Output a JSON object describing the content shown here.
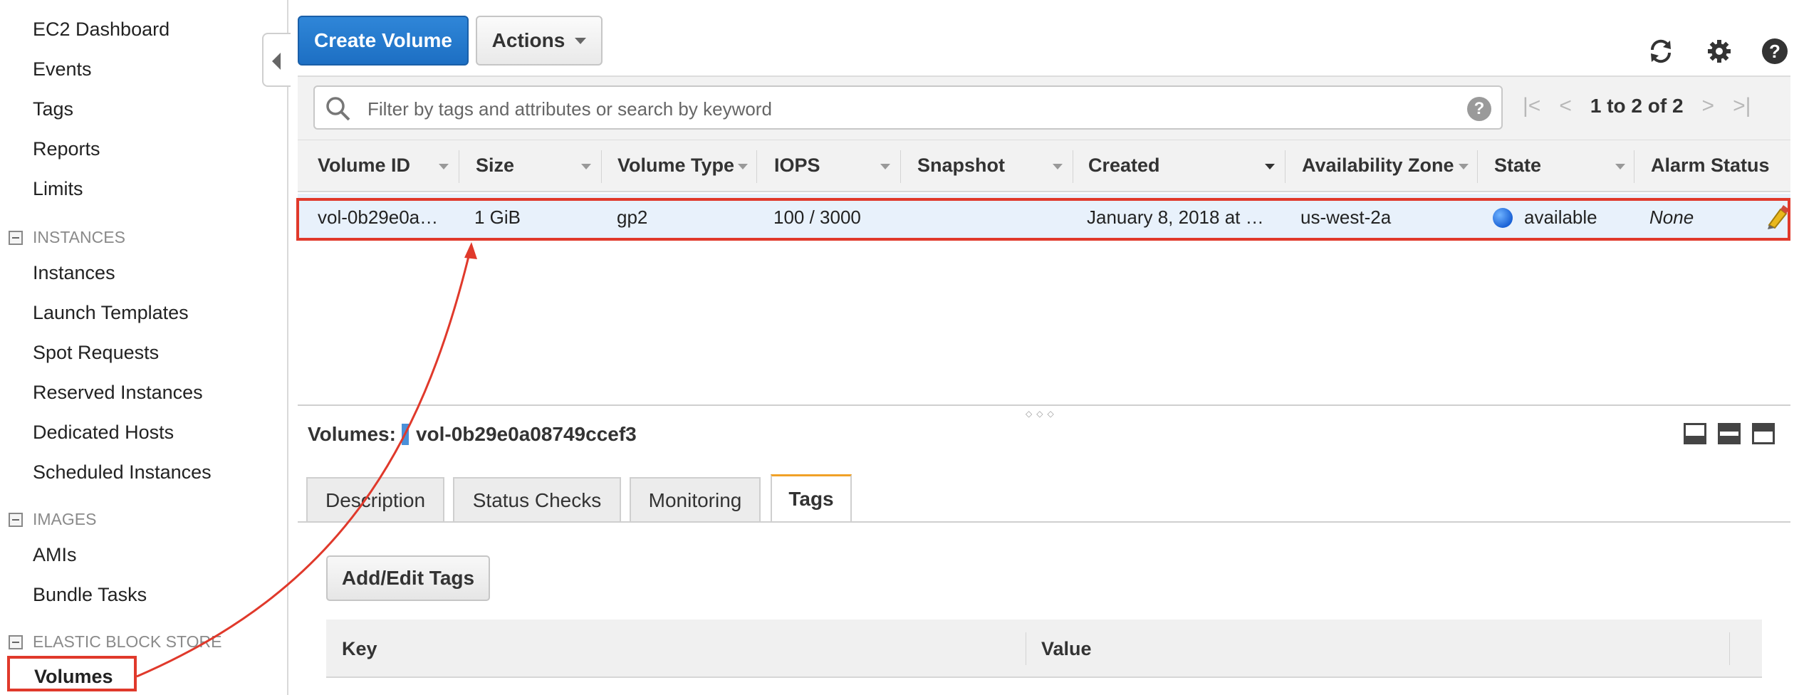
{
  "sidebar": {
    "items_top": [
      "EC2 Dashboard",
      "Events",
      "Tags",
      "Reports",
      "Limits"
    ],
    "group_instances": "INSTANCES",
    "items_instances": [
      "Instances",
      "Launch Templates",
      "Spot Requests",
      "Reserved Instances",
      "Dedicated Hosts",
      "Scheduled Instances"
    ],
    "group_images": "IMAGES",
    "items_images": [
      "AMIs",
      "Bundle Tasks"
    ],
    "group_ebs": "ELASTIC BLOCK STORE",
    "items_ebs": [
      "Volumes"
    ]
  },
  "toolbar": {
    "create_label": "Create Volume",
    "actions_label": "Actions"
  },
  "filter": {
    "placeholder": "Filter by tags and attributes or search by keyword",
    "help": "?",
    "pager_text": "1 to 2 of 2"
  },
  "table": {
    "columns": [
      "Volume ID",
      "Size",
      "Volume Type",
      "IOPS",
      "Snapshot",
      "Created",
      "Availability Zone",
      "State",
      "Alarm Status"
    ],
    "rows": [
      {
        "volume_id": "vol-0b29e0a…",
        "size": "1 GiB",
        "volume_type": "gp2",
        "iops": "100 / 3000",
        "snapshot": "",
        "created": "January 8, 2018 at …",
        "availability_zone": "us-west-2a",
        "state": "available",
        "alarm_status": "None"
      }
    ]
  },
  "details": {
    "title_prefix": "Volumes:",
    "selected_volume": "vol-0b29e0a08749ccef3",
    "tabs": [
      "Description",
      "Status Checks",
      "Monitoring",
      "Tags"
    ],
    "active_tab": "Tags",
    "add_edit_tags_label": "Add/Edit Tags",
    "tags_columns": [
      "Key",
      "Value"
    ]
  },
  "colors": {
    "primary_button": "#1d6fc3",
    "highlight_red": "#e0392b",
    "selected_row": "#e8f1fb",
    "active_tab_accent": "#f0a127"
  }
}
